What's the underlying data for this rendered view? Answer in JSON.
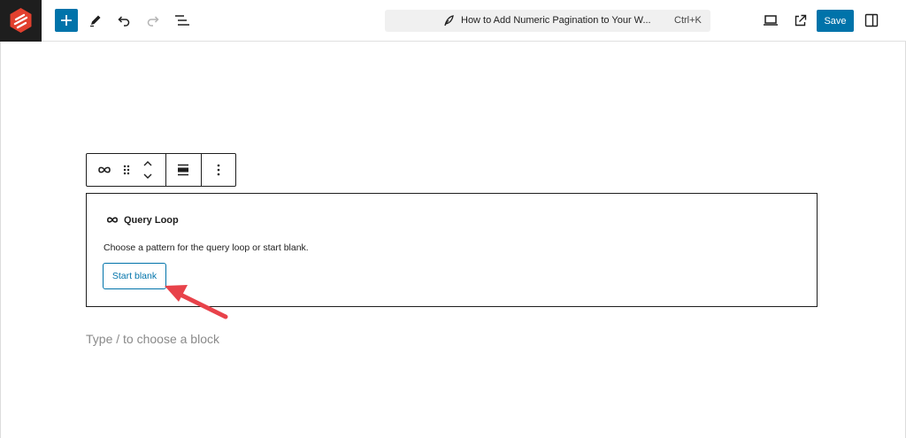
{
  "topbar": {
    "command_bar": {
      "title": "How to Add Numeric Pagination to Your W...",
      "shortcut": "Ctrl+K"
    },
    "save_label": "Save"
  },
  "block": {
    "title": "Query Loop",
    "description": "Choose a pattern for the query loop or start blank.",
    "start_blank_label": "Start blank"
  },
  "editor": {
    "placeholder": "Type / to choose a block"
  },
  "colors": {
    "accent": "#0073aa",
    "annotation_arrow": "#e8424a"
  }
}
